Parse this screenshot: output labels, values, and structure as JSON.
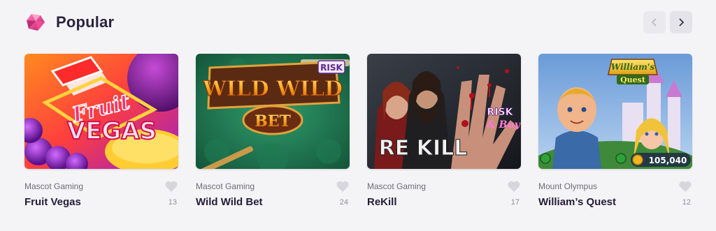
{
  "section": {
    "title": "Popular"
  },
  "nav": {
    "prev_icon": "chevron-left-icon",
    "next_icon": "chevron-right-icon"
  },
  "colors": {
    "accent_pink": "#e6338a",
    "background": "#f4f4f6"
  },
  "games": [
    {
      "provider": "Mascot Gaming",
      "name": "Fruit Vegas",
      "likes": "13",
      "art_text": [
        "Fruit",
        "VEGAS"
      ]
    },
    {
      "provider": "Mascot Gaming",
      "name": "Wild Wild Bet",
      "likes": "24",
      "art_text": [
        "WILD WILD",
        "BET",
        "RISK"
      ]
    },
    {
      "provider": "Mascot Gaming",
      "name": "ReKill",
      "likes": "17",
      "art_text": [
        "RE KILL",
        "RISK",
        "& Buy"
      ]
    },
    {
      "provider": "Mount Olympus",
      "name": "William’s Quest",
      "likes": "12",
      "art_text": [
        "William's",
        "Quest",
        "105,040"
      ]
    }
  ]
}
